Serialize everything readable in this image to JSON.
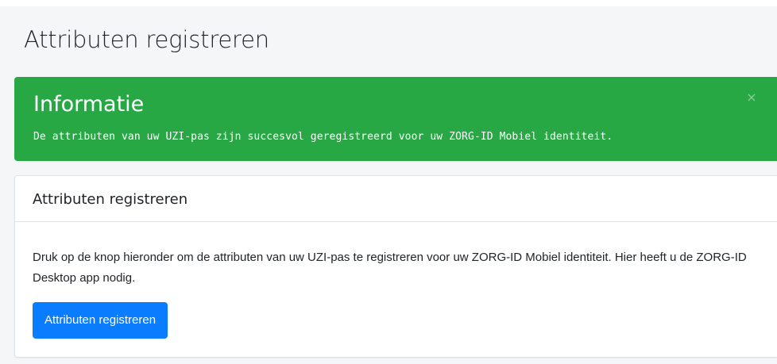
{
  "page": {
    "title": "Attributen registreren"
  },
  "alert": {
    "heading": "Informatie",
    "message": "De attributen van uw UZI-pas zijn succesvol geregistreerd voor uw ZORG-ID Mobiel identiteit.",
    "close_label": "×",
    "color": "#28a745"
  },
  "card": {
    "title": "Attributen registreren",
    "body": "Druk op de knop hieronder om de attributen van uw UZI-pas te registreren voor uw ZORG-ID Mobiel identiteit. Hier heeft u de ZORG-ID Desktop app nodig.",
    "button_label": "Attributen registreren",
    "button_color": "#0a7cff"
  }
}
